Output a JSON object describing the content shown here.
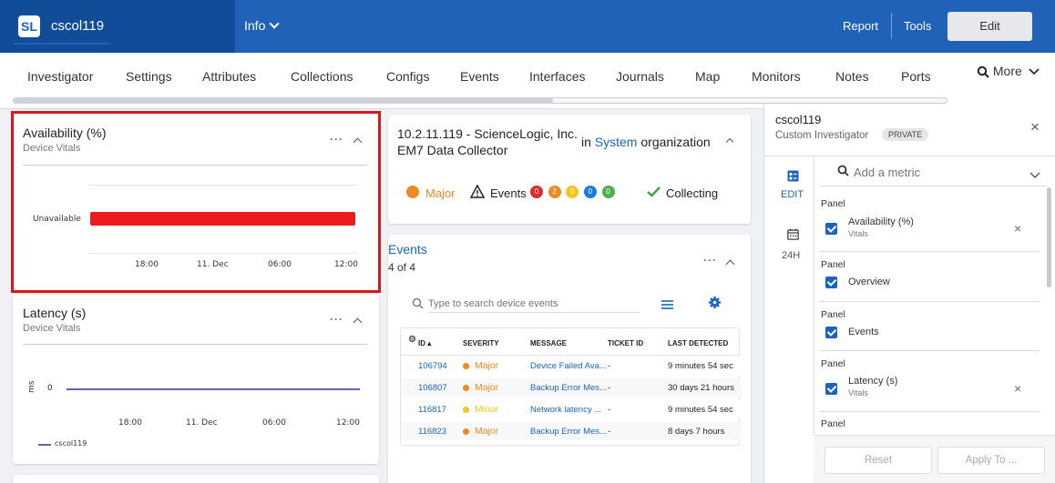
{
  "topbar": {
    "logo_text": "SL",
    "device_name": "cscol119",
    "info_label": "Info",
    "report_label": "Report",
    "tools_label": "Tools",
    "edit_label": "Edit"
  },
  "tabs": [
    "Investigator",
    "Settings",
    "Attributes",
    "Collections",
    "Configs",
    "Events",
    "Interfaces",
    "Journals",
    "Map",
    "Monitors",
    "Notes",
    "Ports"
  ],
  "more_label": "More",
  "availability": {
    "title": "Availability (%)",
    "subtitle": "Device Vitals",
    "row_label": "Unavailable",
    "ticks": [
      "18:00",
      "11. Dec",
      "06:00",
      "12:00"
    ],
    "bar_color": "#ee1c1c"
  },
  "latency": {
    "title": "Latency (s)",
    "subtitle": "Device Vitals",
    "y_unit": "ms",
    "y_tick": "0",
    "ticks": [
      "18:00",
      "11. Dec",
      "06:00",
      "12:00"
    ],
    "legend": "cscol119",
    "line_color": "#6a5fb0"
  },
  "chart_data": [
    {
      "type": "bar",
      "title": "Availability (%)",
      "categories": [
        "Unavailable"
      ],
      "x_ticks": [
        "18:00",
        "11. Dec",
        "06:00",
        "12:00"
      ],
      "values": [
        1
      ]
    },
    {
      "type": "line",
      "title": "Latency (s)",
      "ylabel": "ms",
      "x_ticks": [
        "18:00",
        "11. Dec",
        "06:00",
        "12:00"
      ],
      "series": [
        {
          "name": "cscol119",
          "values": [
            0,
            0
          ]
        }
      ]
    }
  ],
  "device_card": {
    "line1": "10.2.11.119 - ScienceLogic, Inc.",
    "line2": "EM7 Data Collector",
    "in_label": "in",
    "org_link": "System",
    "org_suffix": "organization",
    "severity": "Major",
    "events_label": "Events",
    "event_counts": [
      "0",
      "2",
      "0",
      "0",
      "0"
    ],
    "event_colors": [
      "#e02b2b",
      "#f08a24",
      "#f5c518",
      "#1c7ae0",
      "#4caf50"
    ],
    "collecting": "Collecting"
  },
  "events": {
    "title": "Events",
    "count": "4 of 4",
    "search_placeholder": "Type to search device events",
    "columns": [
      "ID",
      "SEVERITY",
      "MESSAGE",
      "TICKET ID",
      "LAST DETECTED"
    ],
    "rows": [
      {
        "id": "106794",
        "sev": "Major",
        "sev_color": "#f08a24",
        "msg": "Device Failed Ava...",
        "ticket": "-",
        "last": "9 minutes 54 sec"
      },
      {
        "id": "106807",
        "sev": "Major",
        "sev_color": "#f08a24",
        "msg": "Backup Error Mes...",
        "ticket": "-",
        "last": "30 days 21 hours"
      },
      {
        "id": "116817",
        "sev": "Minor",
        "sev_color": "#f5c518",
        "msg": "Network latency ...",
        "ticket": "-",
        "last": "9 minutes 54 sec"
      },
      {
        "id": "116823",
        "sev": "Major",
        "sev_color": "#f08a24",
        "msg": "Backup Error Mes...",
        "ticket": "-",
        "last": "8 days 7 hours"
      }
    ]
  },
  "side": {
    "title": "cscol119",
    "subtitle": "Custom Investigator",
    "badge": "PRIVATE",
    "edit_label": "EDIT",
    "range_label": "24H",
    "metric_placeholder": "Add a metric",
    "panel_word": "Panel",
    "panels": [
      {
        "label": "Availability (%)",
        "sub": "Vitals"
      },
      {
        "label": "Overview",
        "sub": ""
      },
      {
        "label": "Events",
        "sub": ""
      },
      {
        "label": "Latency (s)",
        "sub": "Vitals"
      }
    ],
    "reset_label": "Reset",
    "apply_label": "Apply To ..."
  }
}
